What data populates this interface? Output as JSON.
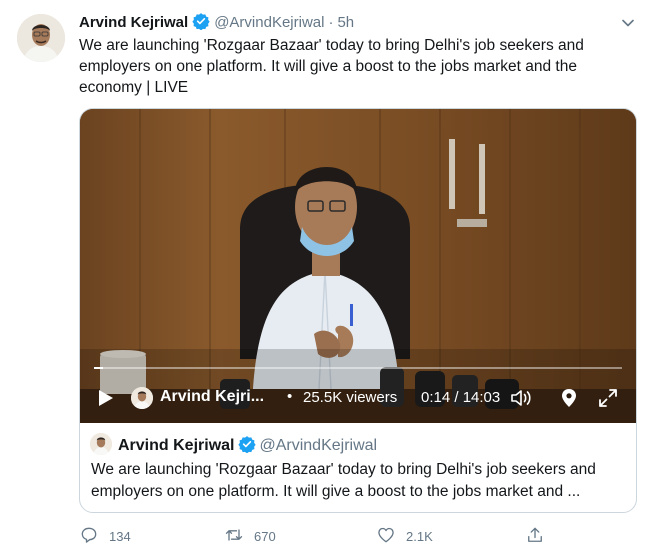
{
  "tweet": {
    "author_name": "Arvind Kejriwal",
    "author_handle": "@ArvindKejriwal",
    "separator": "·",
    "time_ago": "5h",
    "text": "We are launching 'Rozgaar Bazaar' today to bring Delhi's job seekers and employers on one platform. It will give a boost to the jobs market and the economy | LIVE"
  },
  "video": {
    "broadcaster_name": "Arvind Kejri...",
    "bullet": "•",
    "viewers": "25.5K viewers",
    "timecode": "0:14 / 14:03",
    "progress": 0.017,
    "icons": [
      "play-icon",
      "volume-icon",
      "location-pin-icon",
      "expand-icon"
    ]
  },
  "quote": {
    "author_name": "Arvind Kejriwal",
    "author_handle": "@ArvindKejriwal",
    "text": "We are launching 'Rozgaar Bazaar' today to bring Delhi's job seekers and employers on one platform. It will give a boost to the jobs market and ..."
  },
  "actions": {
    "reply_count": "134",
    "retweet_count": "670",
    "like_count": "2.1K"
  },
  "colors": {
    "text": "#14171a",
    "secondary": "#657786",
    "verified": "#1da1f2",
    "border": "#ccd6dd"
  }
}
